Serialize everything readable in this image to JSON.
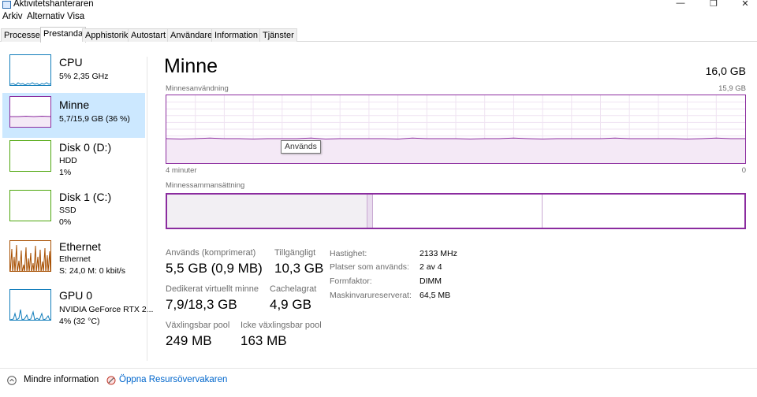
{
  "window": {
    "title": "Aktivitetshanteraren",
    "controls": {
      "minimize": "—",
      "restore": "❐",
      "close": "✕"
    }
  },
  "menu": [
    "Arkiv",
    "Alternativ",
    "Visa"
  ],
  "tabs": [
    "Processer",
    "Prestanda",
    "Apphistorik",
    "Autostart",
    "Användare",
    "Information",
    "Tjänster"
  ],
  "active_tab": "Prestanda",
  "sidebar": [
    {
      "name": "CPU",
      "line1": "5%  2,35 GHz",
      "line2": "",
      "color": "#117dbb",
      "selected": false
    },
    {
      "name": "Minne",
      "line1": "5,7/15,9 GB (36 %)",
      "line2": "",
      "color": "#8b2c9f",
      "selected": true
    },
    {
      "name": "Disk 0 (D:)",
      "line1": "HDD",
      "line2": "1%",
      "color": "#4da60c",
      "selected": false
    },
    {
      "name": "Disk 1 (C:)",
      "line1": "SSD",
      "line2": "0%",
      "color": "#4da60c",
      "selected": false
    },
    {
      "name": "Ethernet",
      "line1": "Ethernet",
      "line2": "S:  24,0  M:  0 kbit/s",
      "color": "#a74f01",
      "selected": false
    },
    {
      "name": "GPU 0",
      "line1": "NVIDIA GeForce RTX 2...",
      "line2": "4%  (32 °C)",
      "color": "#117dbb",
      "selected": false
    }
  ],
  "main": {
    "title": "Minne",
    "total": "16,0 GB",
    "usage_graph": {
      "label": "Minnesanvändning",
      "max_label": "15,9 GB",
      "time_left": "4 minuter",
      "time_right": "0",
      "tooltip": "Används",
      "usage_fraction": 0.36
    },
    "composition": {
      "label": "Minnessammansättning",
      "in_use_fraction": 0.345,
      "modified_fraction": 0.012,
      "standby_fraction": 0.293
    },
    "stats": [
      {
        "label": "Används (komprimerat)",
        "value": "5,5 GB (0,9 MB)"
      },
      {
        "label": "Tillgängligt",
        "value": "10,3 GB"
      },
      {
        "label": "Dedikerat virtuellt minne",
        "value": "7,9/18,3 GB"
      },
      {
        "label": "Cachelagrat",
        "value": "4,9 GB"
      },
      {
        "label": "Växlingsbar pool",
        "value": "249 MB"
      },
      {
        "label": "Icke växlingsbar pool",
        "value": "163 MB"
      }
    ],
    "details": [
      {
        "label": "Hastighet:",
        "value": "2133 MHz"
      },
      {
        "label": "Platser som används:",
        "value": "2 av 4"
      },
      {
        "label": "Formfaktor:",
        "value": "DIMM"
      },
      {
        "label": "Maskinvarureserverat:",
        "value": "64,5 MB"
      }
    ]
  },
  "footer": {
    "fewer_details": "Mindre information",
    "open_resmon": "Öppna Resursövervakaren"
  },
  "colors": {
    "memory": "#8b2c9f",
    "selection": "#cce8ff",
    "link": "#0066cc"
  }
}
